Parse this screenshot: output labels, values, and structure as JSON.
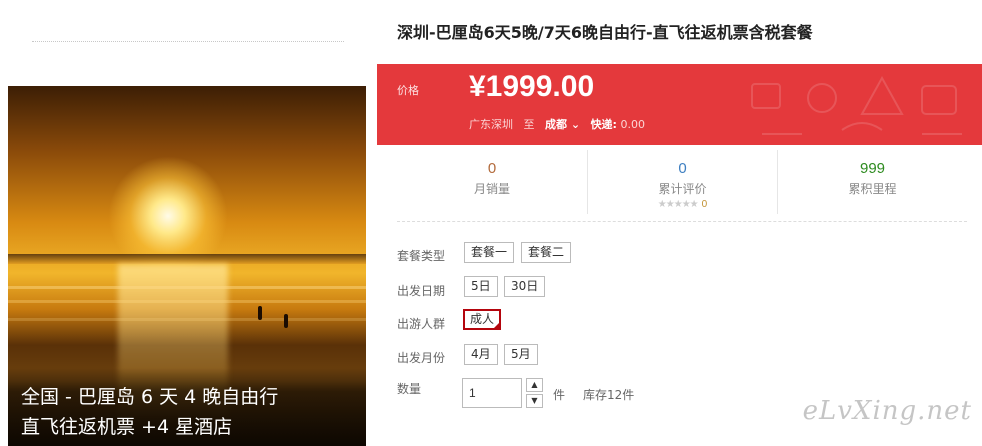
{
  "product": {
    "title": "深圳-巴厘岛6天5晚/7天6晚自由行-直飞往返机票含税套餐",
    "image_caption_line1": "全国 - 巴厘岛 6 天 4 晚自由行",
    "image_caption_line2": "直飞往返机票 +4 星酒店"
  },
  "price": {
    "label": "价格",
    "value": "¥1999.00",
    "origin": "广东深圳",
    "to_label": "至",
    "destination": "成都",
    "express_label": "快递:",
    "express_fee": "0.00"
  },
  "stats": [
    {
      "value": "0",
      "label": "月销量",
      "color": "#b36b3c"
    },
    {
      "value": "0",
      "label": "累计评价",
      "color": "#3e7fc1",
      "stars": "★★★★★",
      "review_count": "0"
    },
    {
      "value": "999",
      "label": "累积里程",
      "color": "#2e8b20"
    }
  ],
  "options": {
    "package": {
      "label": "套餐类型",
      "items": [
        "套餐一",
        "套餐二"
      ]
    },
    "departure_date": {
      "label": "出发日期",
      "items": [
        "5日",
        "30日"
      ]
    },
    "traveler": {
      "label": "出游人群",
      "items": [
        "成人"
      ],
      "selected": "成人"
    },
    "departure_month": {
      "label": "出发月份",
      "items": [
        "4月",
        "5月"
      ]
    },
    "quantity": {
      "label": "数量",
      "value": "1",
      "unit": "件",
      "stock": "库存12件"
    }
  },
  "watermark": "eLvXing.net",
  "colors": {
    "accent": "#e4393c",
    "selected_border": "#b4050d"
  }
}
